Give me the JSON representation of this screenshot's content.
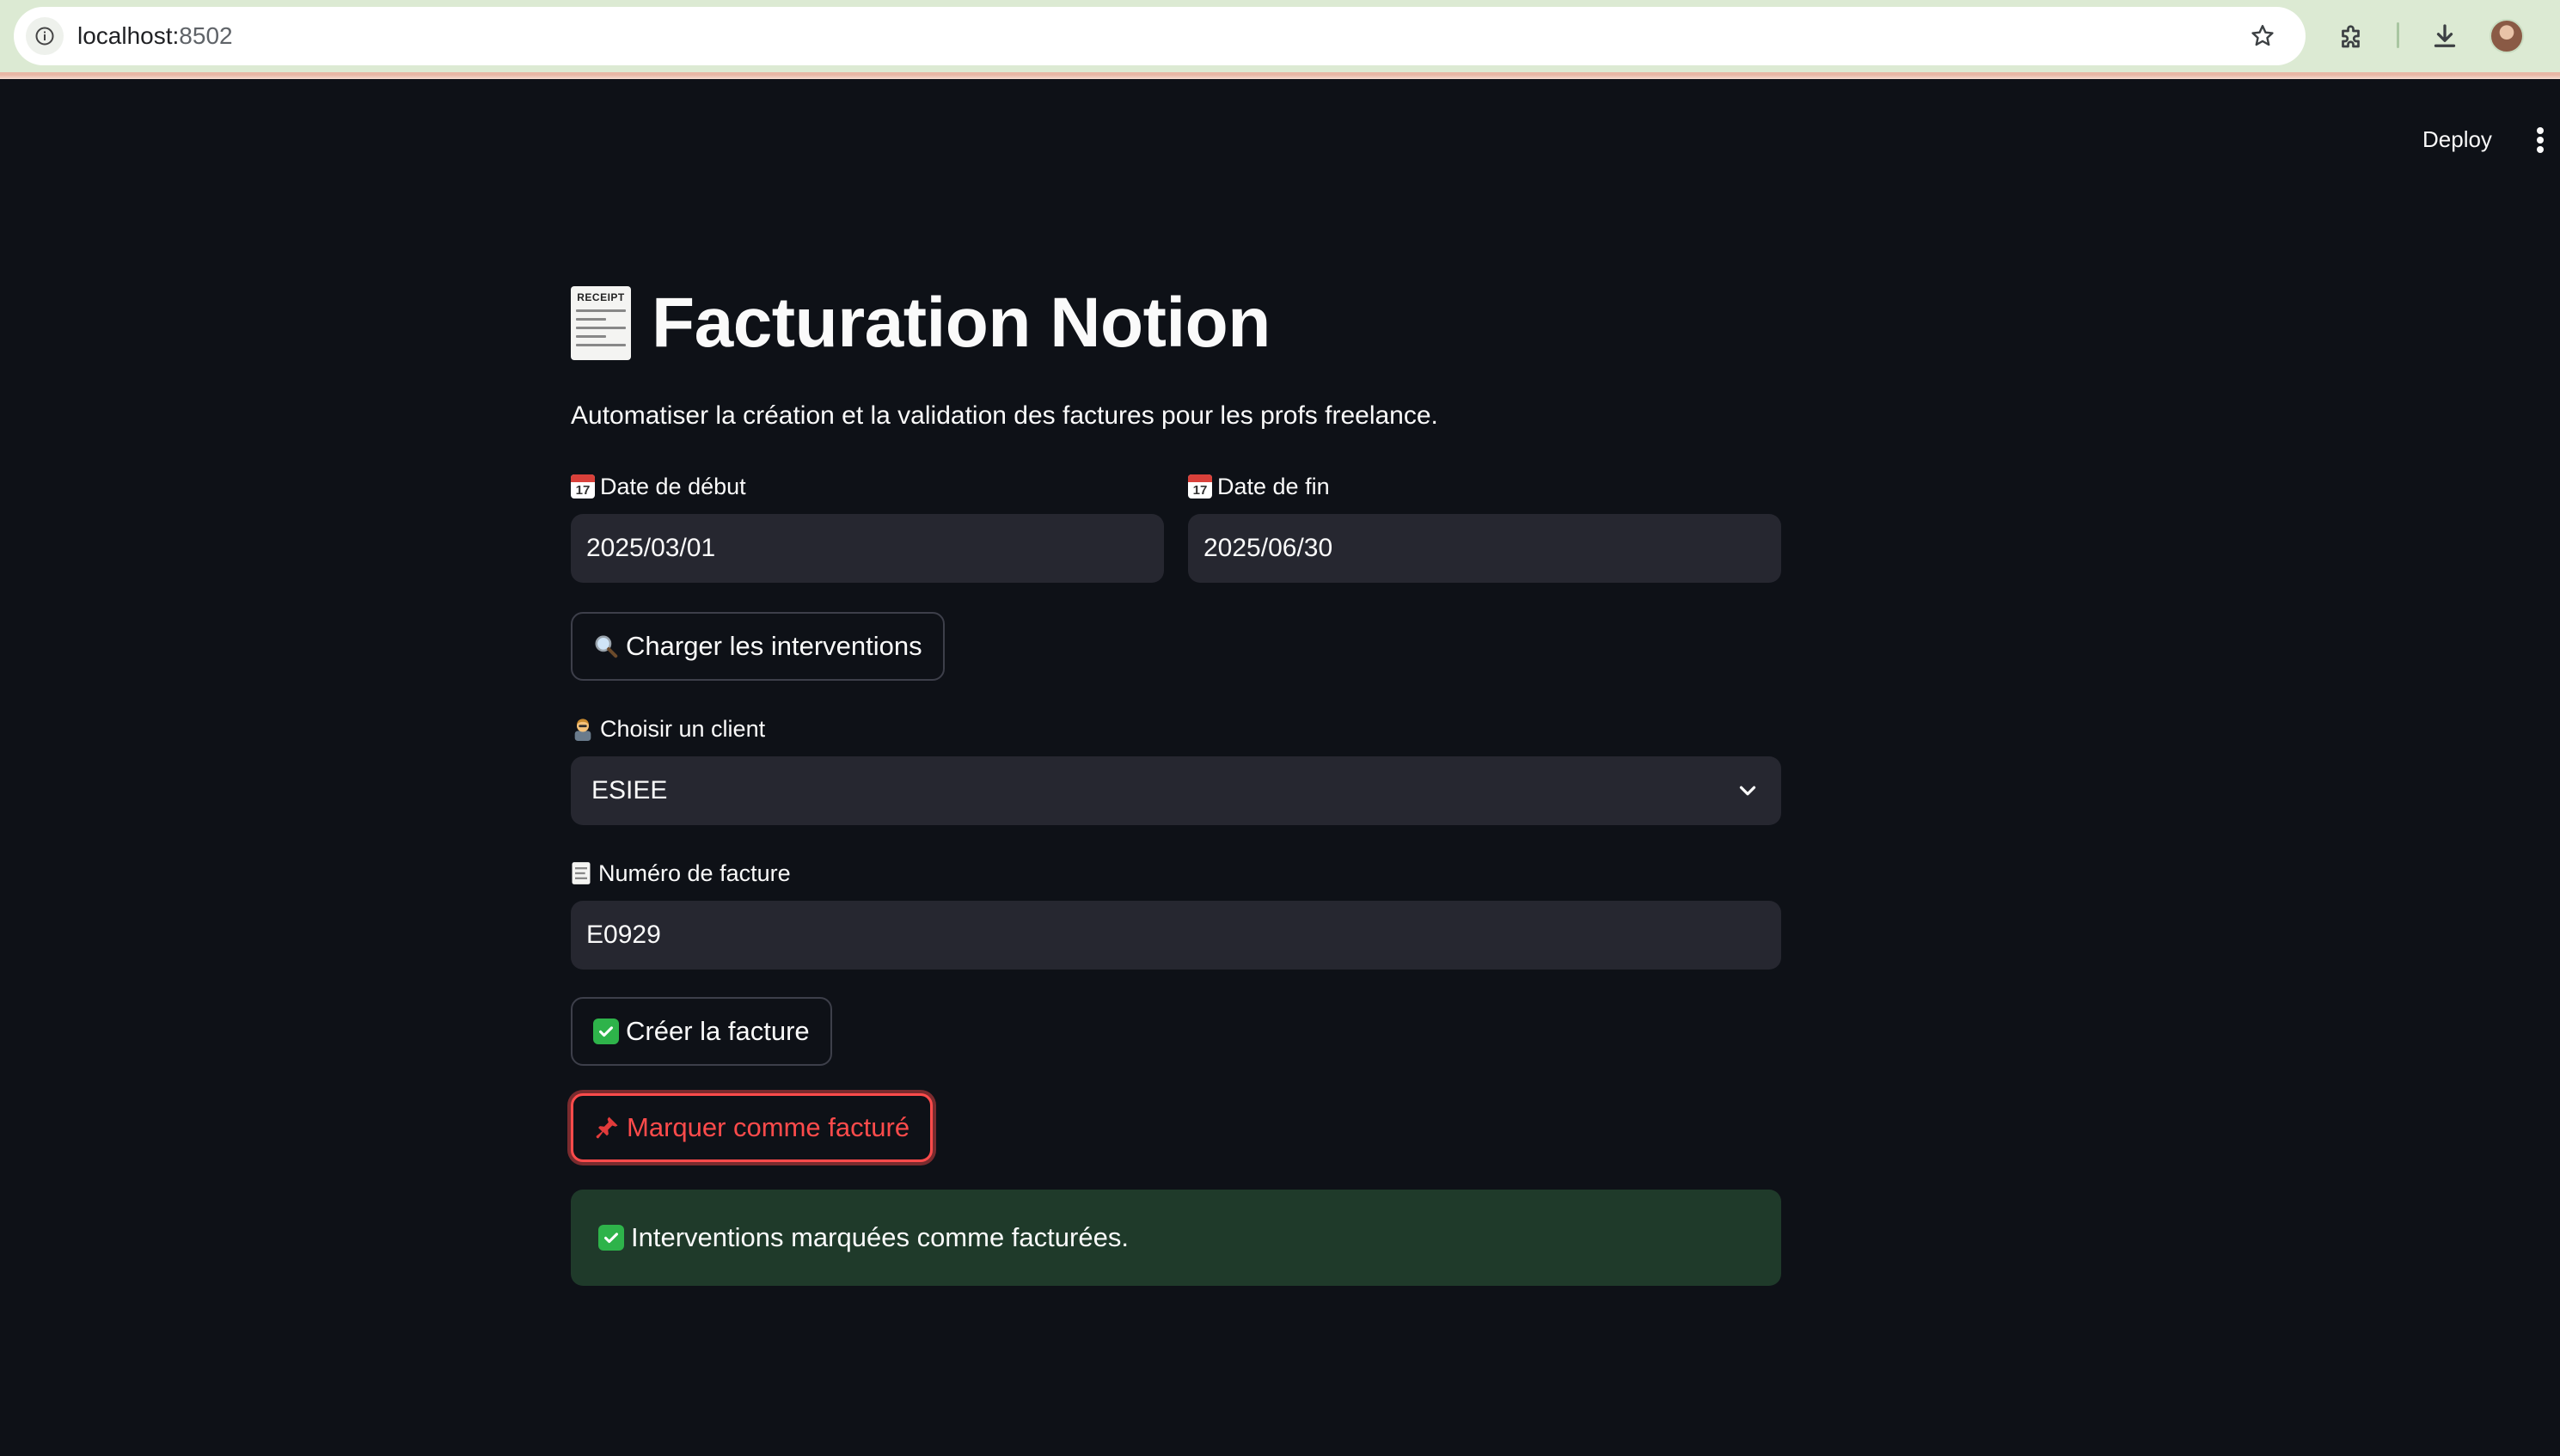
{
  "browser": {
    "url_host": "localhost:",
    "url_port": "8502"
  },
  "header": {
    "deploy_label": "Deploy"
  },
  "page": {
    "receipt_icon_text": "RECEIPT",
    "title": "Facturation Notion",
    "subtitle": "Automatiser la création et la validation des factures pour les profs freelance."
  },
  "form": {
    "start_date": {
      "label": "Date de début",
      "value": "2025/03/01",
      "icon_day": "17"
    },
    "end_date": {
      "label": "Date de fin",
      "value": "2025/06/30",
      "icon_day": "17"
    },
    "load_button_label": "Charger les interventions",
    "client": {
      "label": "Choisir un client",
      "value": "ESIEE"
    },
    "invoice_number": {
      "label": "Numéro de facture",
      "value": "E0929"
    },
    "create_button_label": "Créer la facture",
    "mark_button_label": "Marquer comme facturé",
    "success_message": "Interventions marquées comme facturées."
  },
  "colors": {
    "background": "#0e1117",
    "input_bg": "#262730",
    "accent_red": "#ff4b4b",
    "success_bg": "#1f3a2a",
    "chrome_bg": "#dcead3"
  },
  "icons": {
    "site_info": "info-icon",
    "bookmark": "star-icon",
    "extensions": "puzzle-icon",
    "download": "download-icon",
    "title": "receipt-icon",
    "date": "calendar-icon",
    "load": "magnifying-glass-icon",
    "client": "person-icon",
    "invoice": "memo-icon",
    "create": "check-mark-icon",
    "mark": "pushpin-icon",
    "success": "check-mark-icon"
  }
}
